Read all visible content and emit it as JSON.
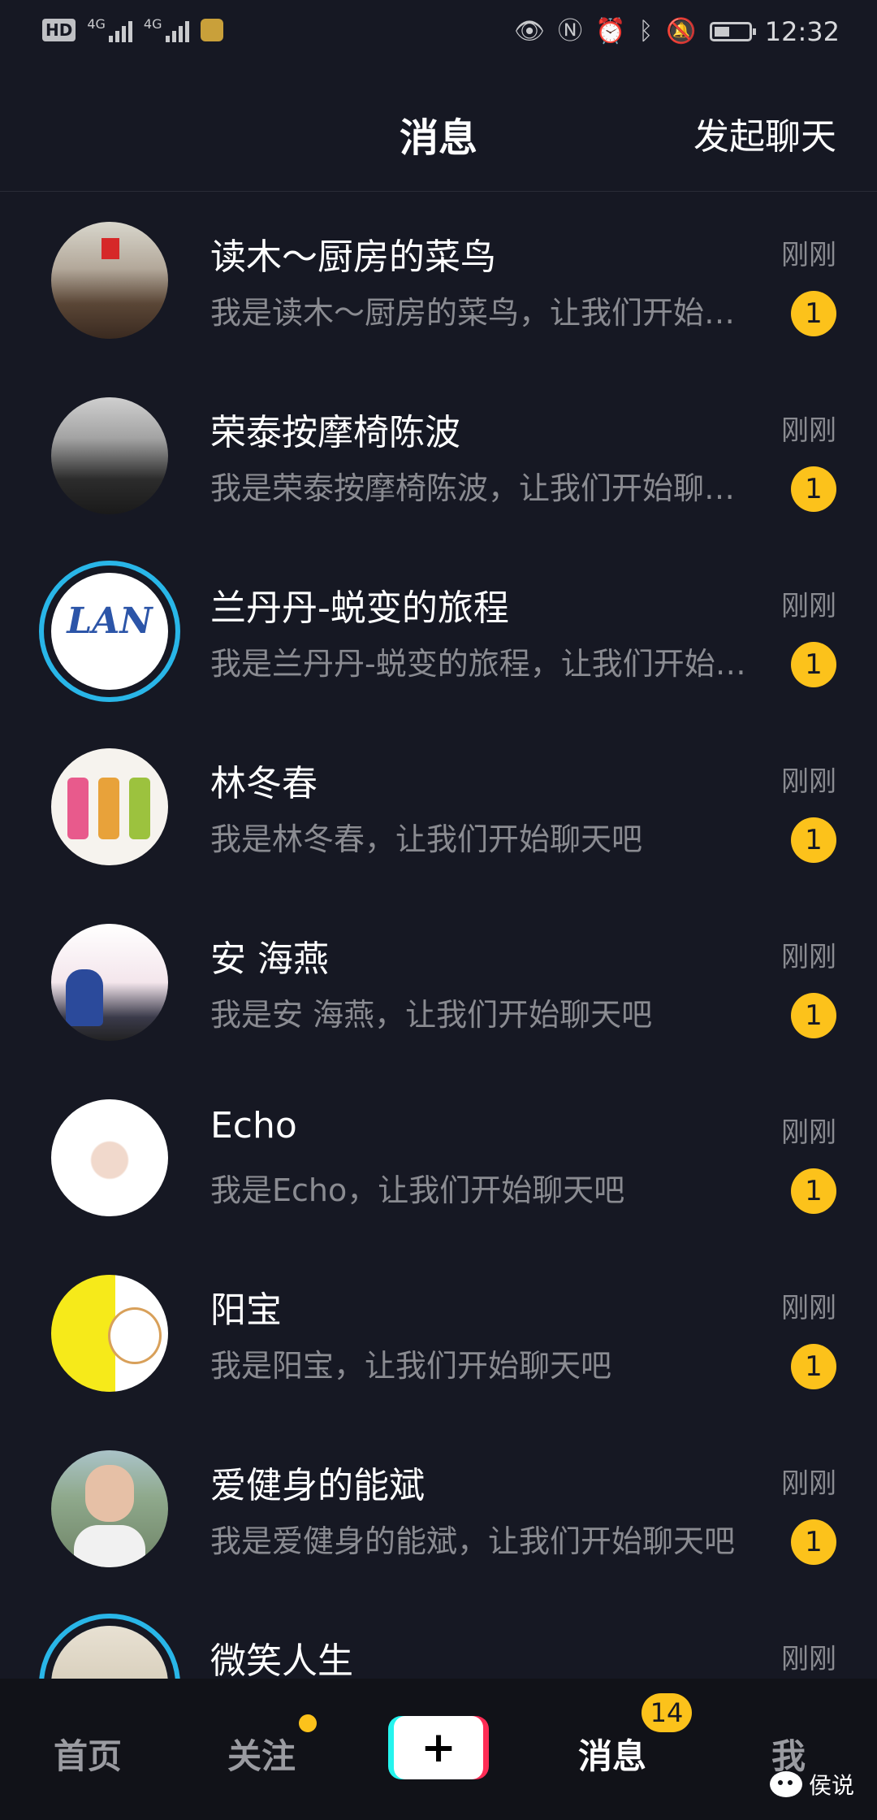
{
  "status_bar": {
    "hd": "HD",
    "net1": "4G",
    "net2": "4G",
    "icons": [
      "eye-icon",
      "nfc-icon",
      "alarm-icon",
      "bluetooth-icon",
      "mute-icon"
    ],
    "battery_level": 0.45,
    "time": "12:32"
  },
  "header": {
    "title": "消息",
    "action": "发起聊天"
  },
  "conversations": [
    {
      "name": "读木～厨房的菜鸟",
      "preview": "我是读木～厨房的菜鸟，让我们开始聊天吧",
      "time": "刚刚",
      "unread": "1"
    },
    {
      "name": "荣泰按摩椅陈波",
      "preview": "我是荣泰按摩椅陈波，让我们开始聊天吧",
      "time": "刚刚",
      "unread": "1"
    },
    {
      "name": "兰丹丹-蜕变的旅程",
      "preview": "我是兰丹丹-蜕变的旅程，让我们开始聊天吧",
      "time": "刚刚",
      "unread": "1",
      "avatar_text": "LAN"
    },
    {
      "name": "林冬春",
      "preview": "我是林冬春，让我们开始聊天吧",
      "time": "刚刚",
      "unread": "1"
    },
    {
      "name": "安 海燕",
      "preview": "我是安 海燕，让我们开始聊天吧",
      "time": "刚刚",
      "unread": "1"
    },
    {
      "name": "Echo",
      "preview": "我是Echo，让我们开始聊天吧",
      "time": "刚刚",
      "unread": "1"
    },
    {
      "name": "阳宝",
      "preview": "我是阳宝，让我们开始聊天吧",
      "time": "刚刚",
      "unread": "1"
    },
    {
      "name": "爱健身的能斌",
      "preview": "我是爱健身的能斌，让我们开始聊天吧",
      "time": "刚刚",
      "unread": "1"
    },
    {
      "name": "微笑人生",
      "preview": "",
      "time": "刚刚",
      "unread": ""
    }
  ],
  "bottom_nav": {
    "home": "首页",
    "follow": "关注",
    "create": "+",
    "messages": "消息",
    "messages_badge": "14",
    "me": "我"
  },
  "watermark": "侯说",
  "colors": {
    "background": "#161823",
    "accent_badge": "#fcc21b",
    "ring": "#29b6e8",
    "create_left": "#25f4ee",
    "create_right": "#fe2c55"
  }
}
